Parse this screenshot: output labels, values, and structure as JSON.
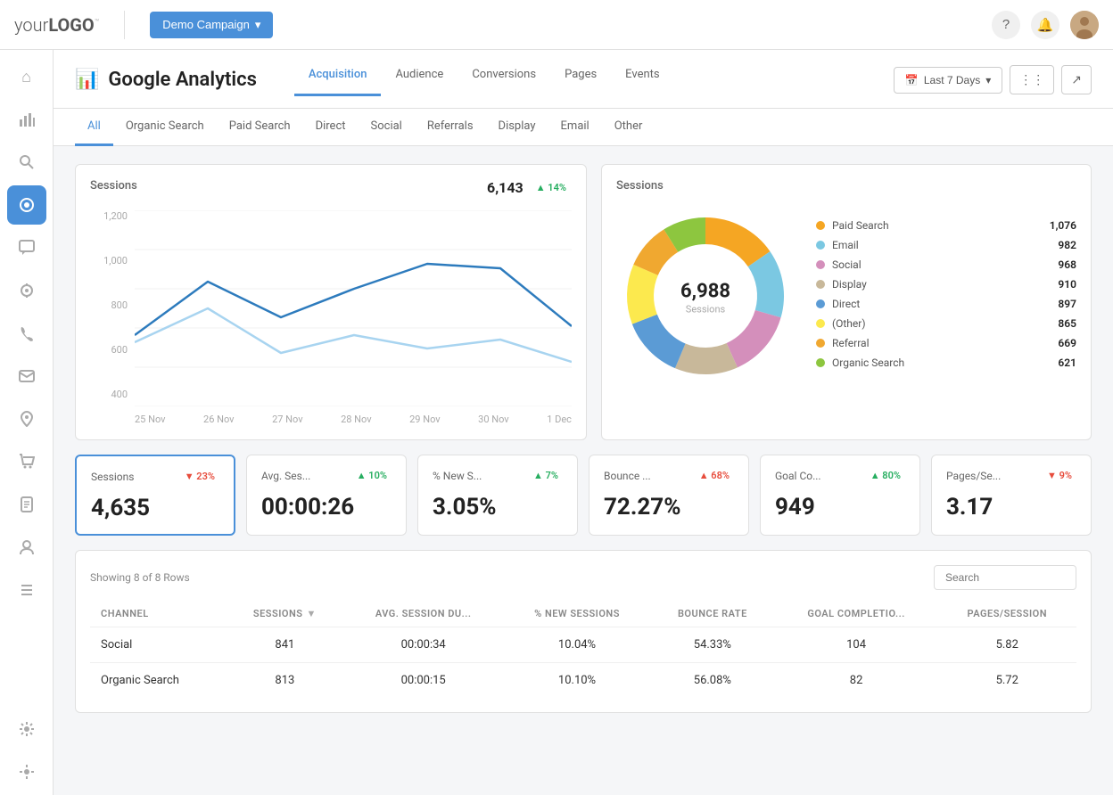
{
  "topNav": {
    "logo": "your",
    "logoBold": "LOGO",
    "logoTrademark": "™",
    "campaignBtn": "Demo Campaign",
    "helpIcon": "?",
    "notifIcon": "🔔"
  },
  "sidebar": {
    "icons": [
      {
        "name": "home",
        "symbol": "⌂",
        "active": false
      },
      {
        "name": "analytics",
        "symbol": "📊",
        "active": false
      },
      {
        "name": "search",
        "symbol": "🔍",
        "active": false
      },
      {
        "name": "pulse",
        "symbol": "⚡",
        "active": true
      },
      {
        "name": "chat",
        "symbol": "💬",
        "active": false
      },
      {
        "name": "insights",
        "symbol": "🔎",
        "active": false
      },
      {
        "name": "phone",
        "symbol": "📞",
        "active": false
      },
      {
        "name": "email",
        "symbol": "✉",
        "active": false
      },
      {
        "name": "location",
        "symbol": "📍",
        "active": false
      },
      {
        "name": "cart",
        "symbol": "🛒",
        "active": false
      },
      {
        "name": "reports",
        "symbol": "📋",
        "active": false
      },
      {
        "name": "users",
        "symbol": "👤",
        "active": false
      },
      {
        "name": "list",
        "symbol": "☰",
        "active": false
      },
      {
        "name": "plugin",
        "symbol": "⚙",
        "active": false
      },
      {
        "name": "settings",
        "symbol": "⚙",
        "active": false
      }
    ]
  },
  "pageHeader": {
    "iconSymbol": "📊",
    "title": "Google Analytics",
    "tabs": [
      {
        "label": "Acquisition",
        "active": true
      },
      {
        "label": "Audience",
        "active": false
      },
      {
        "label": "Conversions",
        "active": false
      },
      {
        "label": "Pages",
        "active": false
      },
      {
        "label": "Events",
        "active": false
      }
    ],
    "datePickerLabel": "Last 7 Days",
    "calendarIcon": "📅"
  },
  "subTabs": [
    {
      "label": "All",
      "active": true
    },
    {
      "label": "Organic Search",
      "active": false
    },
    {
      "label": "Paid Search",
      "active": false
    },
    {
      "label": "Direct",
      "active": false
    },
    {
      "label": "Social",
      "active": false
    },
    {
      "label": "Referrals",
      "active": false
    },
    {
      "label": "Display",
      "active": false
    },
    {
      "label": "Email",
      "active": false
    },
    {
      "label": "Other",
      "active": false
    }
  ],
  "sessionsChart": {
    "title": "Sessions",
    "value": "6,143",
    "trend": "▲ 14%",
    "trendDir": "up",
    "yLabels": [
      "1,200",
      "1,000",
      "800",
      "600",
      "400"
    ],
    "xLabels": [
      "25 Nov",
      "26 Nov",
      "27 Nov",
      "28 Nov",
      "29 Nov",
      "30 Nov",
      "1 Dec"
    ]
  },
  "donutChart": {
    "title": "Sessions",
    "centerValue": "6,988",
    "centerLabel": "Sessions",
    "legend": [
      {
        "label": "Paid Search",
        "value": "1,076",
        "color": "#f5a623"
      },
      {
        "label": "Email",
        "value": "982",
        "color": "#7bc8e2"
      },
      {
        "label": "Social",
        "value": "968",
        "color": "#d48fbb"
      },
      {
        "label": "Display",
        "value": "910",
        "color": "#c8b89a"
      },
      {
        "label": "Direct",
        "value": "897",
        "color": "#5b9bd5"
      },
      {
        "label": "(Other)",
        "value": "865",
        "color": "#fce94e"
      },
      {
        "label": "Referral",
        "value": "669",
        "color": "#f0a830"
      },
      {
        "label": "Organic Search",
        "value": "621",
        "color": "#8dc63f"
      }
    ]
  },
  "kpiCards": [
    {
      "label": "Sessions",
      "value": "4,635",
      "badge": "▼ 23%",
      "badgeDir": "down",
      "selected": true
    },
    {
      "label": "Avg. Ses...",
      "value": "00:00:26",
      "badge": "▲ 10%",
      "badgeDir": "up",
      "selected": false
    },
    {
      "label": "% New S...",
      "value": "3.05%",
      "badge": "▲ 7%",
      "badgeDir": "up",
      "selected": false
    },
    {
      "label": "Bounce ...",
      "value": "72.27%",
      "badge": "▲ 68%",
      "badgeDir": "down",
      "selected": false
    },
    {
      "label": "Goal Co...",
      "value": "949",
      "badge": "▲ 80%",
      "badgeDir": "up",
      "selected": false
    },
    {
      "label": "Pages/Se...",
      "value": "3.17",
      "badge": "▼ 9%",
      "badgeDir": "down",
      "selected": false
    }
  ],
  "table": {
    "rowsInfo": "Showing 8 of 8 Rows",
    "searchPlaceholder": "Search",
    "columns": [
      "CHANNEL",
      "SESSIONS",
      "AVG. SESSION DU...",
      "% NEW SESSIONS",
      "BOUNCE RATE",
      "GOAL COMPLETIO...",
      "PAGES/SESSION"
    ],
    "rows": [
      {
        "channel": "Social",
        "sessions": "841",
        "avgDuration": "00:00:34",
        "newSessions": "10.04%",
        "bounceRate": "54.33%",
        "goalCompletion": "104",
        "pagesSession": "5.82"
      },
      {
        "channel": "Organic Search",
        "sessions": "813",
        "avgDuration": "00:00:15",
        "newSessions": "10.10%",
        "bounceRate": "56.08%",
        "goalCompletion": "82",
        "pagesSession": "5.72"
      }
    ]
  }
}
